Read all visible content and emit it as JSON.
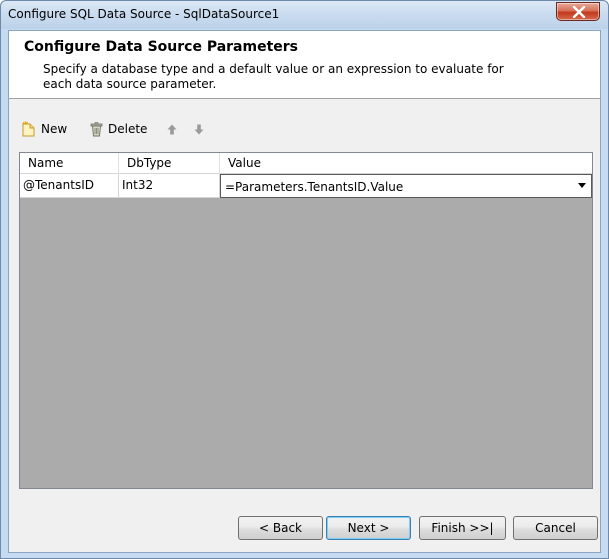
{
  "window": {
    "title": "Configure SQL Data Source - SqlDataSource1"
  },
  "header": {
    "title": "Configure Data Source Parameters",
    "description": "Specify a database type and a default value or an expression to evaluate for each data source parameter."
  },
  "toolbar": {
    "new_label": "New",
    "delete_label": "Delete",
    "new_icon": "new-document-icon",
    "delete_icon": "trash-icon",
    "move_up_icon": "arrow-up-icon",
    "move_down_icon": "arrow-down-icon"
  },
  "grid": {
    "columns": [
      "Name",
      "DbType",
      "Value"
    ],
    "rows": [
      {
        "name": "@TenantsID",
        "dbtype": "Int32",
        "value": "=Parameters.TenantsID.Value"
      }
    ]
  },
  "buttons": {
    "back": "< Back",
    "next": "Next >",
    "finish": "Finish >>|",
    "cancel": "Cancel"
  },
  "colors": {
    "grid_background": "#ababab",
    "title_bar": "#c9dbef",
    "close_button": "#c2391d"
  }
}
